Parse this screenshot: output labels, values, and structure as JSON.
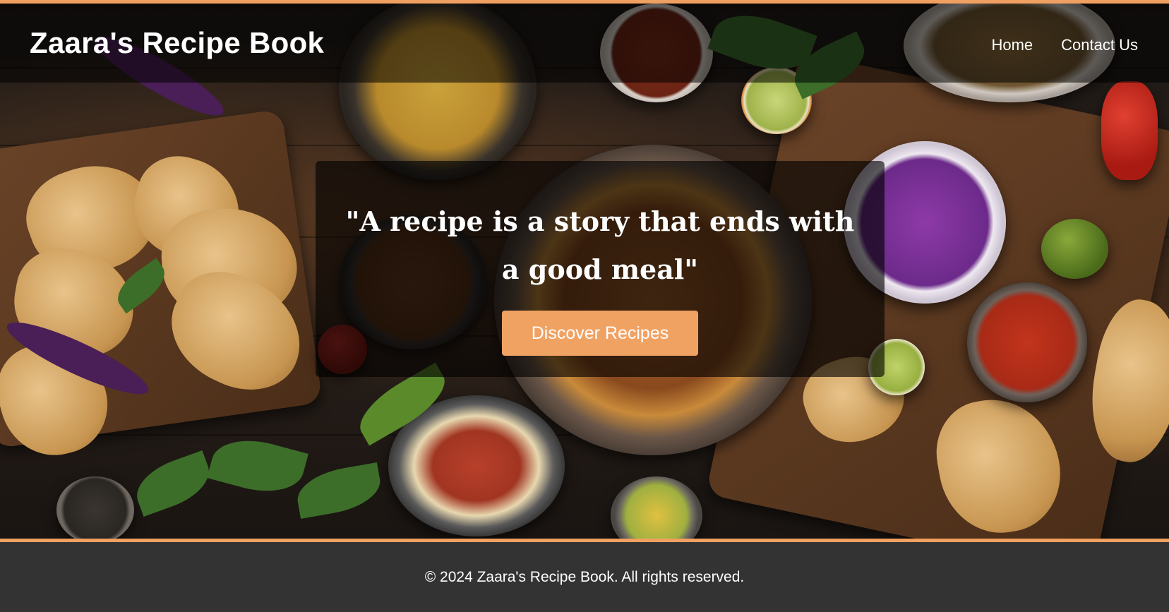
{
  "header": {
    "brand": "Zaara's Recipe Book",
    "nav": [
      {
        "label": "Home"
      },
      {
        "label": "Contact Us"
      }
    ]
  },
  "hero": {
    "quote": "\"A recipe is a story that ends with a good meal\"",
    "cta_label": "Discover Recipes",
    "background_image": "food-table-photo"
  },
  "footer": {
    "copyright": "© 2024 Zaara's Recipe Book. All rights reserved."
  },
  "colors": {
    "accent": "#f0a263",
    "footer_bg": "#333333",
    "text": "#ffffff"
  }
}
